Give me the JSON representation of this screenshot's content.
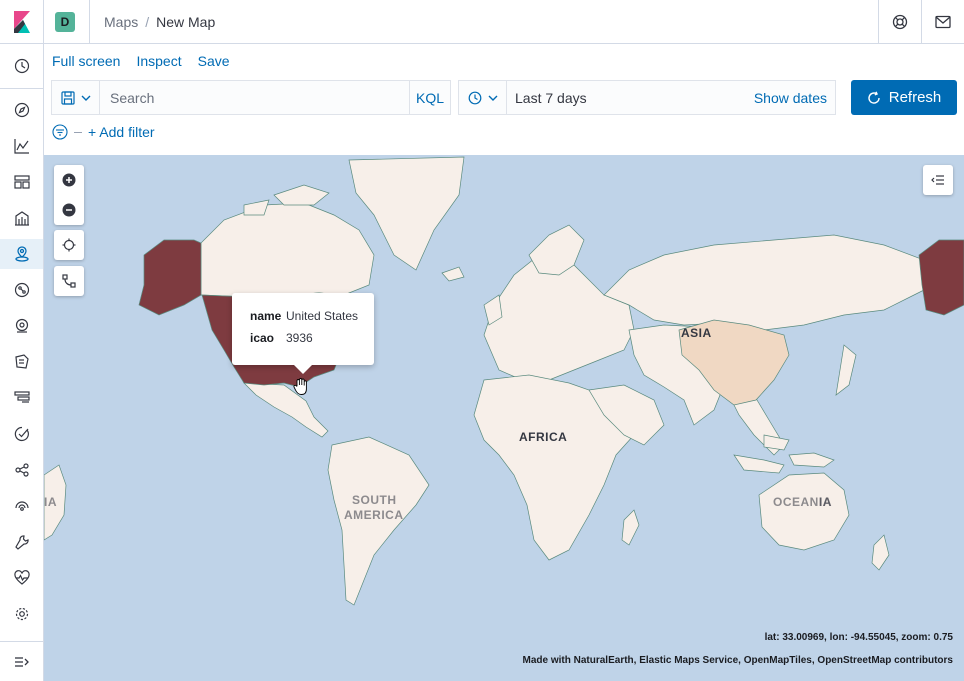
{
  "header": {
    "space_initial": "D",
    "breadcrumbs": [
      "Maps",
      "New Map"
    ]
  },
  "top_menu": {
    "full_screen": "Full screen",
    "inspect": "Inspect",
    "save": "Save"
  },
  "query": {
    "placeholder": "Search",
    "language": "KQL"
  },
  "time": {
    "range": "Last 7 days",
    "show_dates": "Show dates",
    "refresh": "Refresh"
  },
  "filter": {
    "add_filter": "+ Add filter"
  },
  "tooltip": {
    "rows": [
      {
        "key": "name",
        "value": "United States"
      },
      {
        "key": "icao",
        "value": "3936"
      }
    ]
  },
  "map": {
    "labels": {
      "asia": "ASIA",
      "africa": "AFRICA",
      "south_america_1": "SOUTH",
      "south_america_2": "AMERICA",
      "oceania": "OCEANIA",
      "asia_left": "IA",
      "oceania_right": "IA"
    },
    "coords": "lat: 33.00969, lon: -94.55045, zoom: 0.75",
    "attribution": "Made with NaturalEarth, Elastic Maps Service, OpenMapTiles, OpenStreetMap contributors"
  },
  "colors": {
    "accent": "#006bb4",
    "ocean": "#bfd3e8",
    "land": "#f7efe9",
    "highlight": "#7e3b40"
  }
}
